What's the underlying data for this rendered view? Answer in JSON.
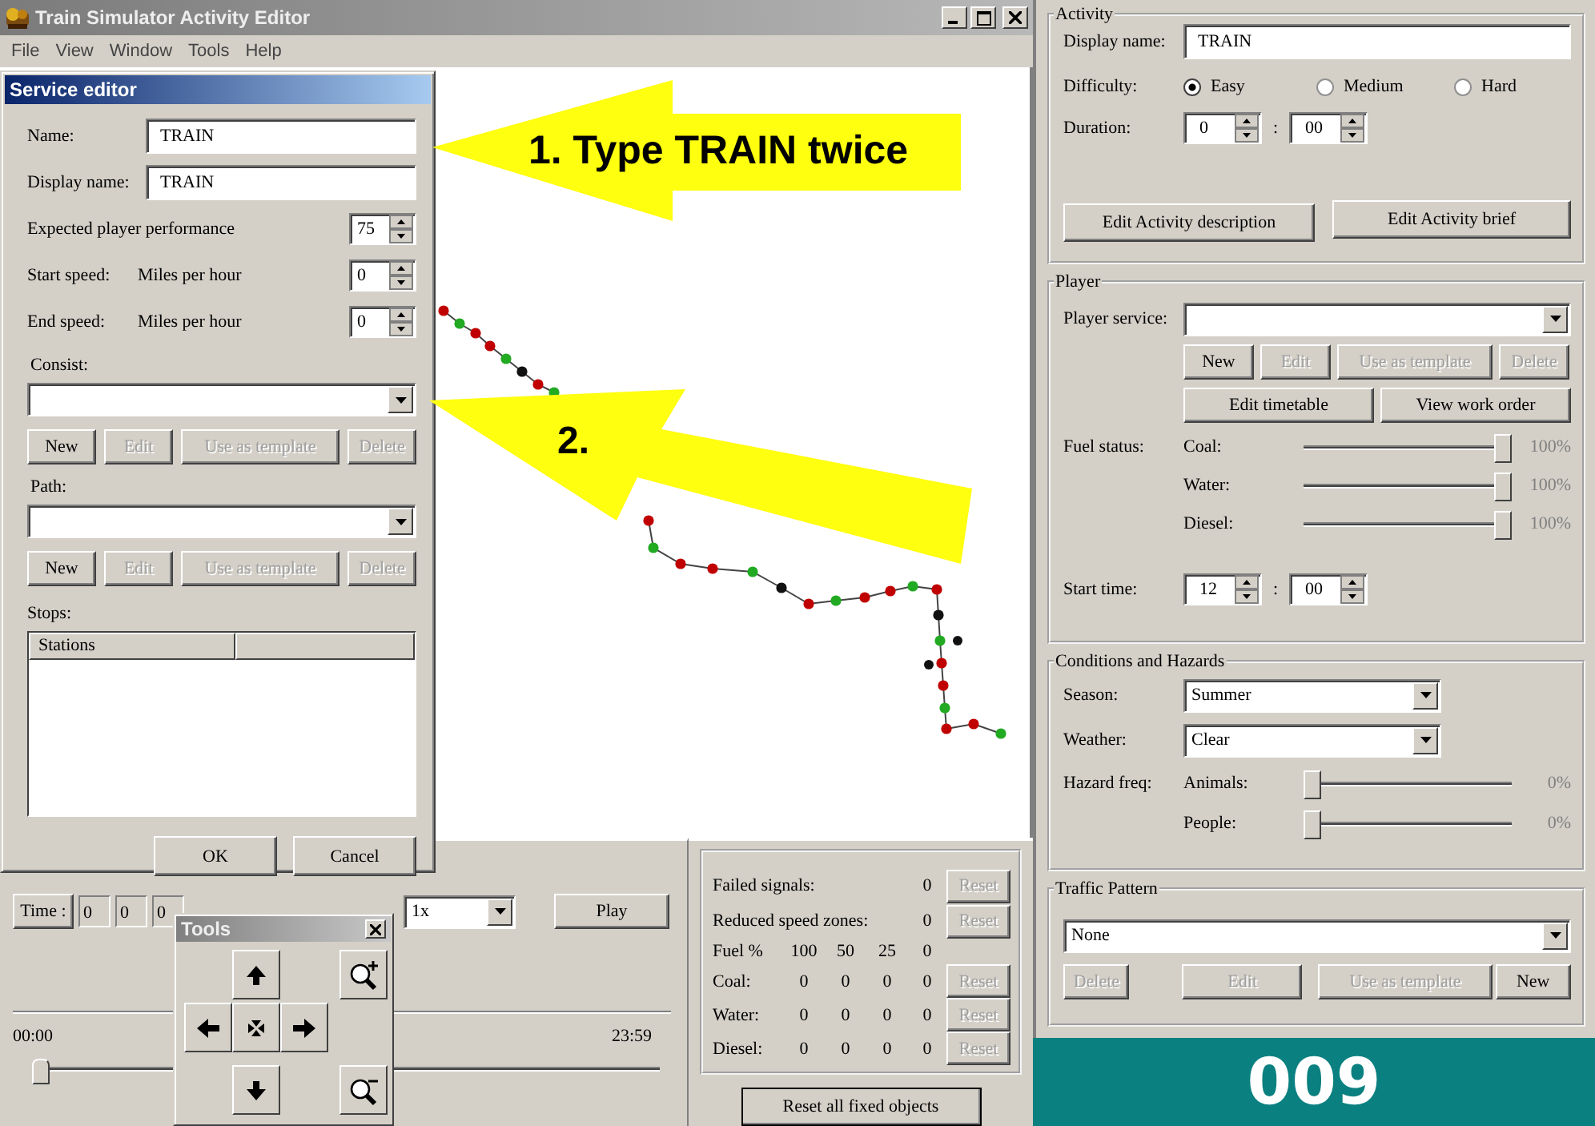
{
  "window": {
    "title": "Train Simulator Activity Editor"
  },
  "menu": [
    "File",
    "View",
    "Window",
    "Tools",
    "Help"
  ],
  "service_editor": {
    "title": "Service editor",
    "fields": [
      {
        "label": "Name:",
        "value": "TRAIN"
      },
      {
        "label": "Display name:",
        "value": "TRAIN"
      }
    ],
    "performance": {
      "label": "Expected player performance",
      "value": "75"
    },
    "speeds": [
      {
        "label": "Start speed:",
        "unit": "Miles per hour",
        "value": "0"
      },
      {
        "label": "End speed:",
        "unit": "Miles per hour",
        "value": "0"
      }
    ],
    "consist": {
      "label": "Consist:",
      "buttons": [
        {
          "label": "New",
          "disabled": false
        },
        {
          "label": "Edit",
          "disabled": true
        },
        {
          "label": "Use as template",
          "disabled": true
        },
        {
          "label": "Delete",
          "disabled": true
        }
      ]
    },
    "path": {
      "label": "Path:",
      "buttons": [
        {
          "label": "New",
          "disabled": false
        },
        {
          "label": "Edit",
          "disabled": true
        },
        {
          "label": "Use as template",
          "disabled": true
        },
        {
          "label": "Delete",
          "disabled": true
        }
      ]
    },
    "stops": {
      "label": "Stops:",
      "columns": [
        "Stations"
      ]
    },
    "buttons": [
      "OK",
      "Cancel"
    ]
  },
  "annotations": [
    {
      "text": "1. Type TRAIN twice"
    },
    {
      "text": "2."
    }
  ],
  "playback": {
    "time_button": "Time :",
    "time_fields": [
      "0",
      "0",
      "0"
    ],
    "speed": "1x",
    "play_button": "Play",
    "start": "00:00",
    "end": "23:59",
    "level": 0
  },
  "tools": {
    "title": "Tools"
  },
  "stats": {
    "rows": [
      {
        "label": "Failed signals:",
        "value": "0",
        "reset": "Reset",
        "disabled": true
      },
      {
        "label": "Reduced speed zones:",
        "value": "0",
        "reset": "Reset",
        "disabled": true
      }
    ],
    "fuel_header": [
      "Fuel %",
      "100",
      "50",
      "25",
      "0"
    ],
    "fuel_rows": [
      {
        "label": "Coal:",
        "values": [
          "0",
          "0",
          "0",
          "0"
        ],
        "reset": "Reset",
        "disabled": true
      },
      {
        "label": "Water:",
        "values": [
          "0",
          "0",
          "0",
          "0"
        ],
        "reset": "Reset",
        "disabled": true
      },
      {
        "label": "Diesel:",
        "values": [
          "0",
          "0",
          "0",
          "0"
        ],
        "reset": "Reset",
        "disabled": true
      }
    ],
    "reset_all": "Reset all fixed objects"
  },
  "activity": {
    "title": "Activity",
    "display_name_label": "Display name:",
    "display_name": "TRAIN",
    "difficulty_label": "Difficulty:",
    "difficulty": [
      {
        "label": "Easy",
        "selected": true
      },
      {
        "label": "Medium",
        "selected": false
      },
      {
        "label": "Hard",
        "selected": false
      }
    ],
    "duration_label": "Duration:",
    "duration": [
      "0",
      "00"
    ],
    "duration_separator": ":",
    "buttons": [
      "Edit Activity description",
      "Edit Activity brief"
    ]
  },
  "player": {
    "title": "Player",
    "service_label": "Player service:",
    "service_buttons": [
      {
        "label": "New",
        "disabled": false
      },
      {
        "label": "Edit",
        "disabled": true
      },
      {
        "label": "Use as template",
        "disabled": true
      },
      {
        "label": "Delete",
        "disabled": true
      }
    ],
    "buttons": [
      "Edit timetable",
      "View work order"
    ],
    "fuel_label": "Fuel status:",
    "fuel": [
      {
        "label": "Coal:",
        "level": 1,
        "reading": "100%"
      },
      {
        "label": "Water:",
        "level": 1,
        "reading": "100%"
      },
      {
        "label": "Diesel:",
        "level": 1,
        "reading": "100%"
      }
    ],
    "start_time_label": "Start time:",
    "start_time": [
      "12",
      "00"
    ],
    "start_time_separator": ":"
  },
  "conditions": {
    "title": "Conditions and Hazards",
    "season_label": "Season:",
    "season": "Summer",
    "weather_label": "Weather:",
    "weather": "Clear",
    "hazard_label": "Hazard freq:",
    "hazards": [
      {
        "label": "Animals:",
        "level": 0,
        "reading": "0%"
      },
      {
        "label": "People:",
        "level": 0,
        "reading": "0%"
      }
    ]
  },
  "traffic": {
    "title": "Traffic Pattern",
    "pattern": "None",
    "buttons": [
      {
        "label": "Delete",
        "disabled": true
      },
      {
        "label": "Edit",
        "disabled": true
      },
      {
        "label": "Use as template",
        "disabled": true
      },
      {
        "label": "New",
        "disabled": false
      }
    ]
  },
  "step": "009"
}
